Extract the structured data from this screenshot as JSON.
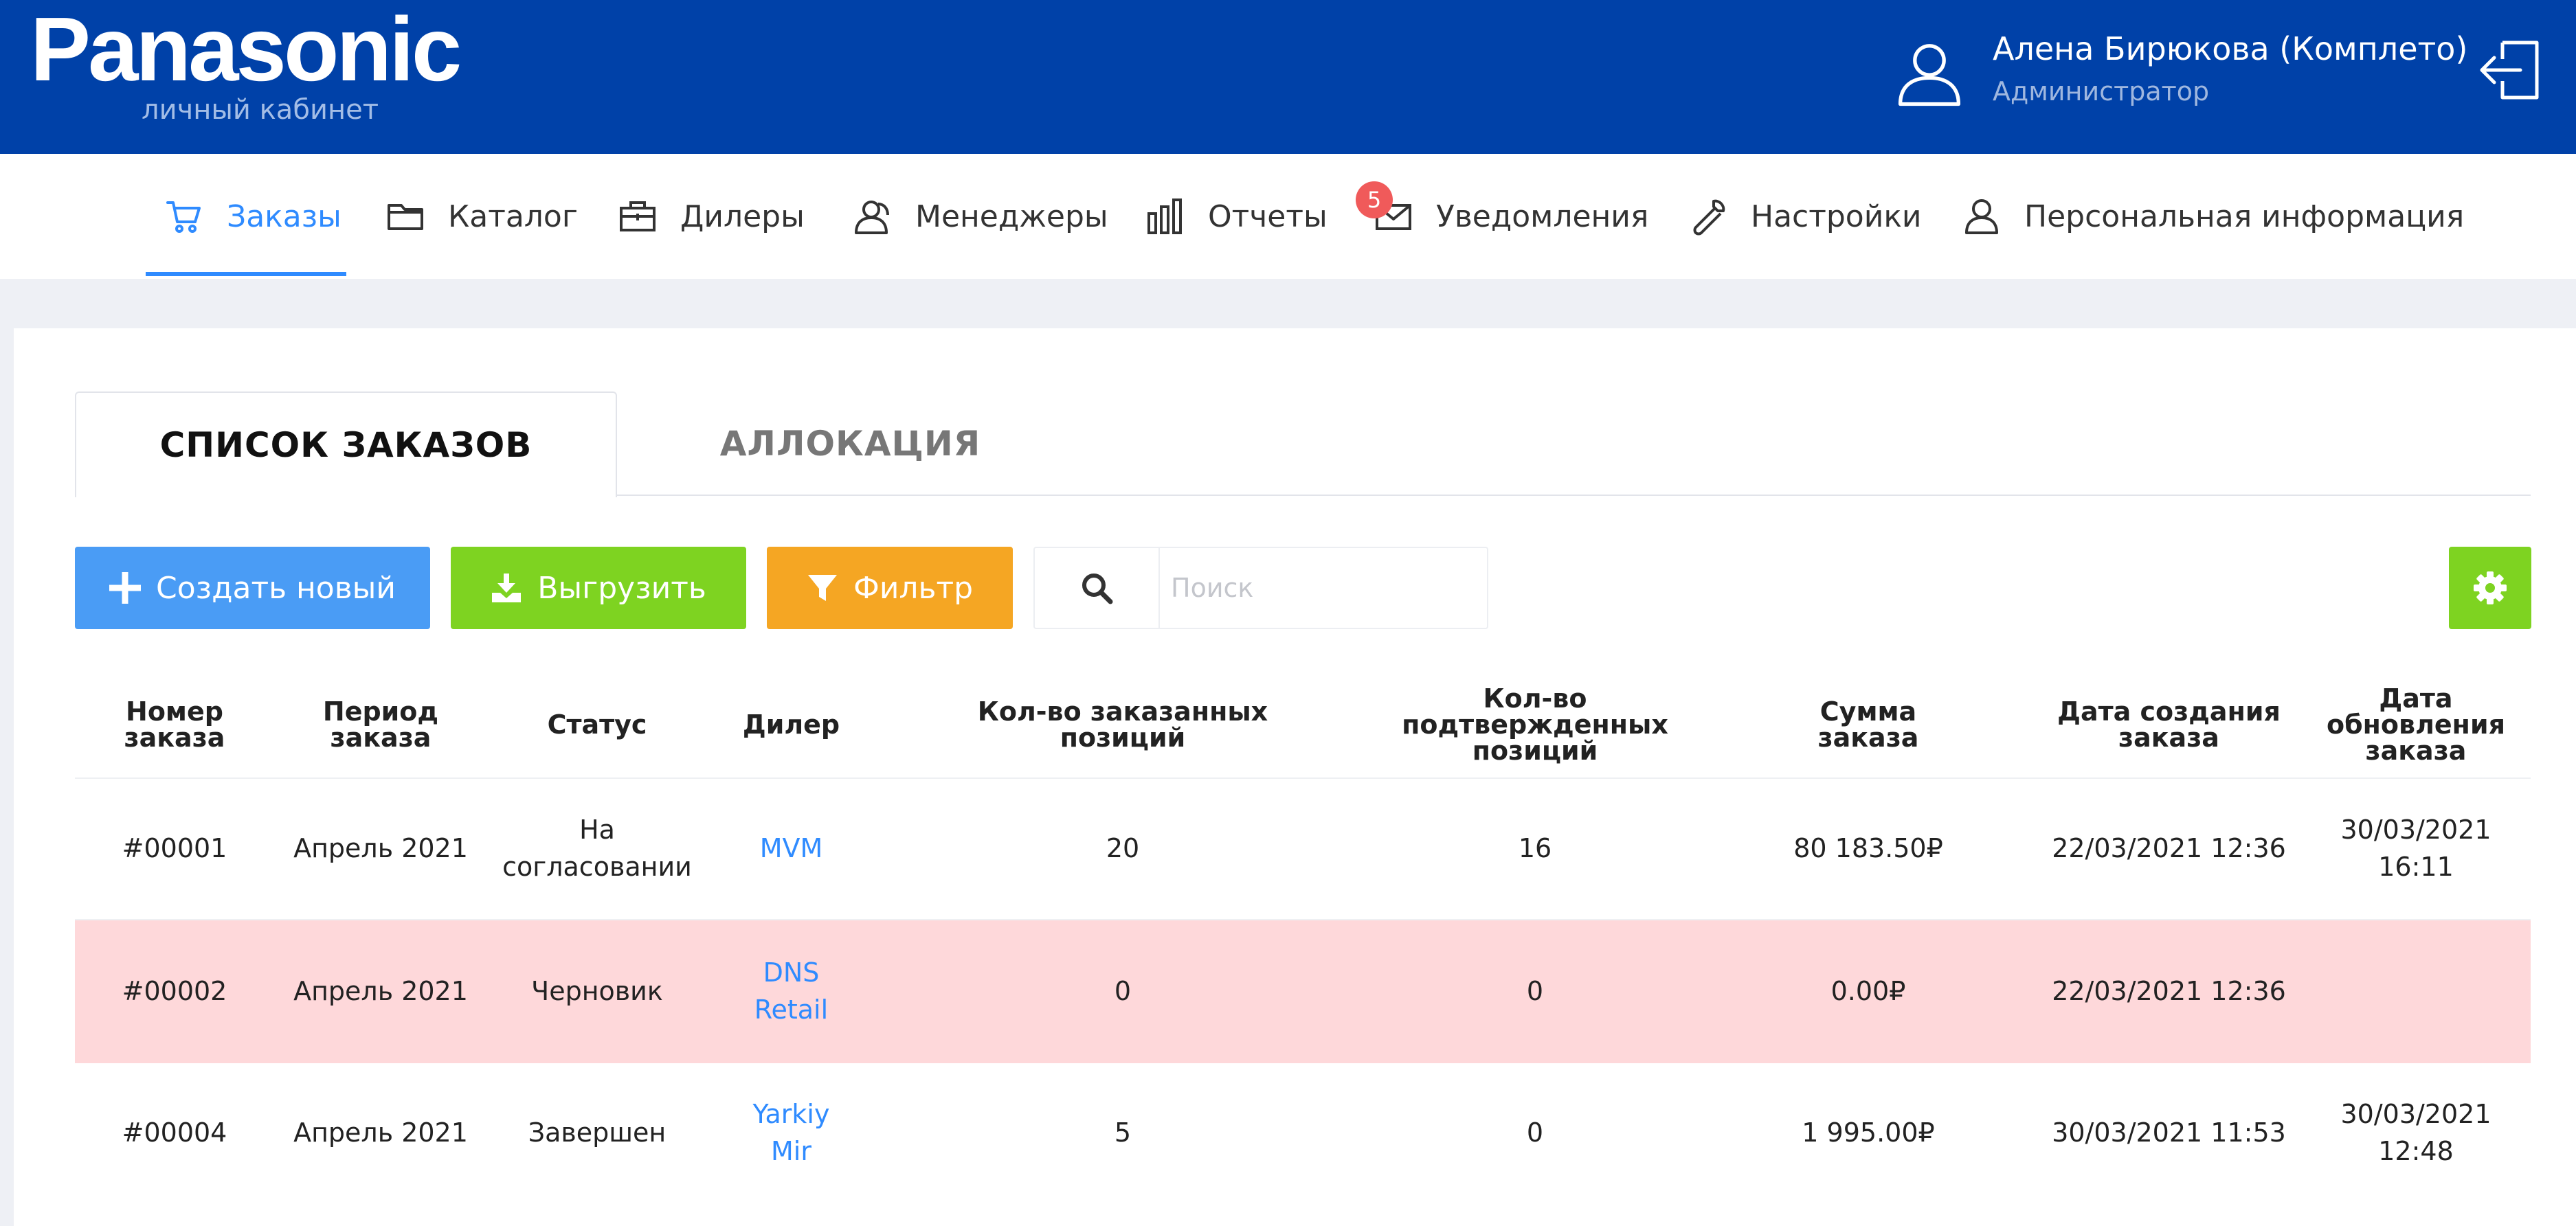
{
  "header": {
    "logo": "Panasonic",
    "logo_sub": "личный кабинет",
    "user_name": "Алена Бирюкова (Комплето)",
    "user_role": "Администратор"
  },
  "nav": {
    "items": [
      {
        "label": "Заказы",
        "icon": "cart-icon",
        "active": true
      },
      {
        "label": "Каталог",
        "icon": "folder-icon"
      },
      {
        "label": "Дилеры",
        "icon": "briefcase-icon"
      },
      {
        "label": "Менеджеры",
        "icon": "managers-icon"
      },
      {
        "label": "Отчеты",
        "icon": "bar-chart-icon"
      },
      {
        "label": "Уведомления",
        "icon": "mail-icon",
        "badge": "5"
      },
      {
        "label": "Настройки",
        "icon": "wrench-icon"
      },
      {
        "label": "Персональная информация",
        "icon": "person-icon"
      }
    ]
  },
  "tabs": {
    "orders": "СПИСОК ЗАКАЗОВ",
    "allocation": "АЛЛОКАЦИЯ"
  },
  "toolbar": {
    "create": "Создать новый",
    "export": "Выгрузить",
    "filter": "Фильтр",
    "search_placeholder": "Поиск"
  },
  "table": {
    "headers": {
      "number": "Номер\nзаказа",
      "period": "Период\nзаказа",
      "status": "Статус",
      "dealer": "Дилер",
      "ordered": "Кол-во заказанных\nпозиций",
      "confirmed": "Кол-во подтвержденных\nпозиций",
      "sum": "Сумма\nзаказа",
      "created": "Дата создания\nзаказа",
      "updated": "Дата обновления\nзаказа"
    },
    "rows": [
      {
        "number": "#00001",
        "period": "Апрель 2021",
        "status": "На\nсогласовании",
        "dealer": "MVM",
        "ordered": "20",
        "confirmed": "16",
        "sum": "80 183.50₽",
        "created": "22/03/2021 12:36",
        "updated": "30/03/2021 16:11"
      },
      {
        "number": "#00002",
        "period": "Апрель 2021",
        "status": "Черновик",
        "dealer": "DNS\nRetail",
        "ordered": "0",
        "confirmed": "0",
        "sum": "0.00₽",
        "created": "22/03/2021 12:36",
        "updated": ""
      },
      {
        "number": "#00004",
        "period": "Апрель 2021",
        "status": "Завершен",
        "dealer": "Yarkiy\nMir",
        "ordered": "5",
        "confirmed": "0",
        "sum": "1 995.00₽",
        "created": "30/03/2021 11:53",
        "updated": "30/03/2021 12:48"
      }
    ]
  },
  "colors": {
    "header_bg": "#0041a8",
    "accent_blue": "#2f8bff",
    "create_btn": "#4a9cf5",
    "export_btn": "#7ed321",
    "filter_btn": "#f5a623",
    "badge": "#f05a5a",
    "row_highlight": "#fed8da"
  }
}
